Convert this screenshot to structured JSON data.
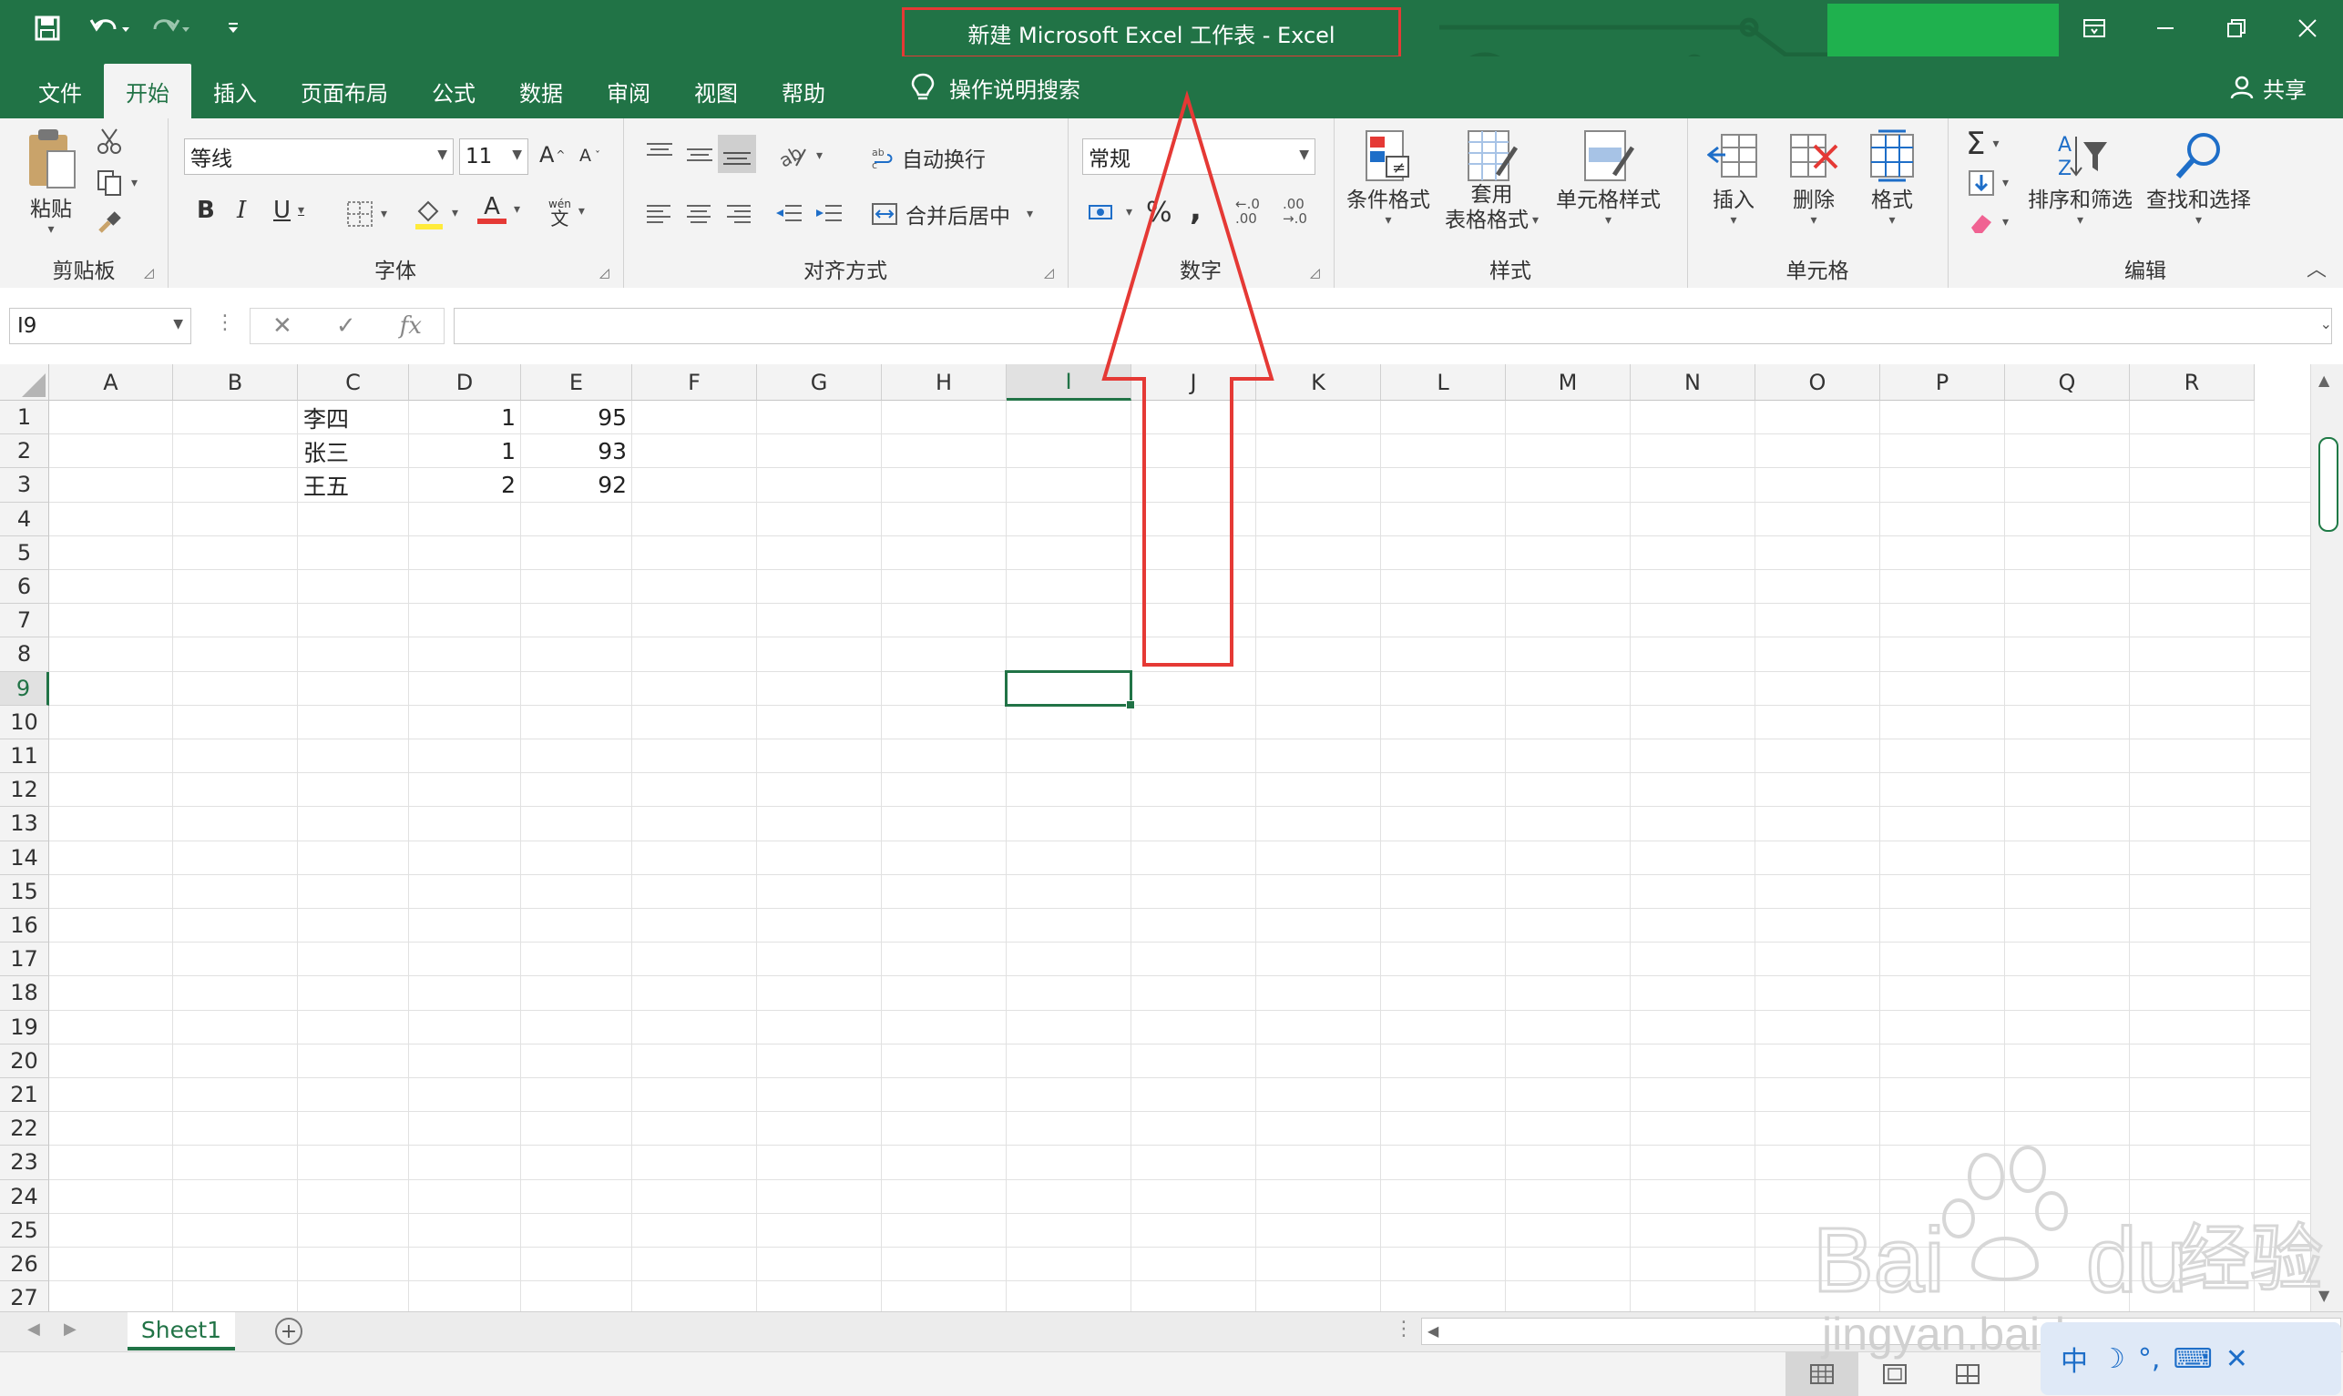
{
  "app": {
    "window_title": "新建 Microsoft Excel 工作表  -  Excel"
  },
  "tabs": [
    {
      "label": "文件"
    },
    {
      "label": "开始"
    },
    {
      "label": "插入"
    },
    {
      "label": "页面布局"
    },
    {
      "label": "公式"
    },
    {
      "label": "数据"
    },
    {
      "label": "审阅"
    },
    {
      "label": "视图"
    },
    {
      "label": "帮助"
    }
  ],
  "tell_me": {
    "label": "操作说明搜索"
  },
  "share": {
    "label": "共享"
  },
  "ribbon": {
    "clipboard": {
      "group": "剪贴板",
      "paste": "粘贴"
    },
    "font": {
      "group": "字体",
      "font_name": "等线",
      "font_size": "11",
      "bold": "B",
      "italic": "I",
      "underline": "U",
      "grow": "A",
      "shrink": "A",
      "font_color": "A",
      "phonetic_top": "wén",
      "phonetic_bottom": "文"
    },
    "alignment": {
      "group": "对齐方式",
      "wrap": "自动换行",
      "merge": "合并后居中"
    },
    "number": {
      "group": "数字",
      "format": "常规",
      "percent": "%",
      "comma": ",",
      "inc_top": "←.0",
      "inc_bottom": ".00",
      "dec_top": ".00",
      "dec_bottom": "→.0"
    },
    "styles": {
      "group": "样式",
      "conditional": "条件格式",
      "table_line1": "套用",
      "table_line2": "表格格式",
      "cell_styles": "单元格样式"
    },
    "cells": {
      "group": "单元格",
      "insert": "插入",
      "delete": "删除",
      "format": "格式"
    },
    "editing": {
      "group": "编辑",
      "autosum": "Σ",
      "sort": "排序和筛选",
      "find": "查找和选择"
    }
  },
  "formula_bar": {
    "name_box": "I9",
    "fx": "fx",
    "value": ""
  },
  "sheet": {
    "columns": [
      "A",
      "B",
      "C",
      "D",
      "E",
      "F",
      "G",
      "H",
      "I",
      "J",
      "K",
      "L",
      "M",
      "N",
      "O",
      "P",
      "Q",
      "R"
    ],
    "rows": [
      "1",
      "2",
      "3",
      "4",
      "5",
      "6",
      "7",
      "8",
      "9",
      "10",
      "11",
      "12",
      "13",
      "14",
      "15",
      "16",
      "17",
      "18",
      "19",
      "20",
      "21",
      "22",
      "23",
      "24",
      "25",
      "26",
      "27"
    ],
    "selected_col": "I",
    "selected_row": "9",
    "data": [
      {
        "C": "李四",
        "D": "1",
        "E": "95"
      },
      {
        "C": "张三",
        "D": "1",
        "E": "93"
      },
      {
        "C": "王五",
        "D": "2",
        "E": "92"
      }
    ]
  },
  "sheet_tabs": [
    {
      "label": "Sheet1"
    }
  ],
  "watermark": {
    "brand_left": "Bai",
    "brand_right": "du",
    "brand_cn": "经验",
    "url": "jingyan.baidu.com",
    "ime": "中"
  }
}
